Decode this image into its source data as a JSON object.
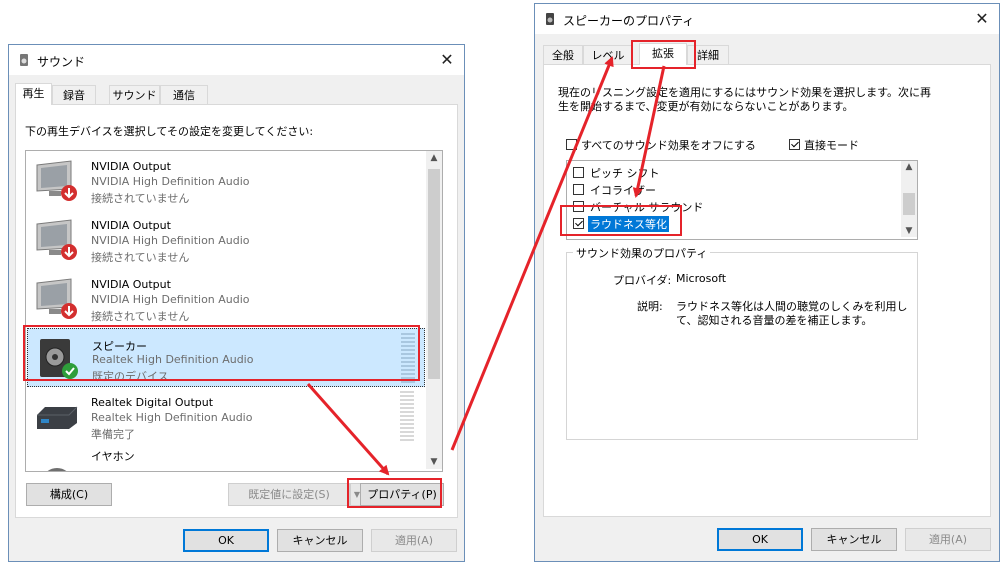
{
  "sound_dialog": {
    "title": "サウンド",
    "tabs": [
      {
        "label": "再生"
      },
      {
        "label": "録音"
      },
      {
        "label": "サウンド"
      },
      {
        "label": "通信"
      }
    ],
    "instruction": "下の再生デバイスを選択してその設定を変更してください:",
    "devices": [
      {
        "name": "NVIDIA Output",
        "driver": "NVIDIA High Definition Audio",
        "status": "接続されていません",
        "icon": "monitor-icon",
        "badge": "disconnected"
      },
      {
        "name": "NVIDIA Output",
        "driver": "NVIDIA High Definition Audio",
        "status": "接続されていません",
        "icon": "monitor-icon",
        "badge": "disconnected"
      },
      {
        "name": "NVIDIA Output",
        "driver": "NVIDIA High Definition Audio",
        "status": "接続されていません",
        "icon": "monitor-icon",
        "badge": "disconnected"
      },
      {
        "name": "スピーカー",
        "driver": "Realtek High Definition Audio",
        "status": "既定のデバイス",
        "icon": "speaker-icon",
        "badge": "default",
        "selected": true
      },
      {
        "name": "Realtek Digital Output",
        "driver": "Realtek High Definition Audio",
        "status": "準備完了",
        "icon": "receiver-icon",
        "badge": "none"
      },
      {
        "name": "イヤホン",
        "driver": "",
        "status": "",
        "icon": "headphone-icon",
        "badge": "none"
      }
    ],
    "configure_label": "構成(C)",
    "set_default_label": "既定値に設定(S)",
    "properties_label": "プロパティ(P)",
    "ok_label": "OK",
    "cancel_label": "キャンセル",
    "apply_label": "適用(A)"
  },
  "speaker_props": {
    "title": "スピーカーのプロパティ",
    "tabs": [
      {
        "label": "全般"
      },
      {
        "label": "レベル"
      },
      {
        "label": "拡張"
      },
      {
        "label": "詳細"
      }
    ],
    "description_line1": "現在のリスニング設定を適用にするにはサウンド効果を選択します。次に再",
    "description_line2": "生を開始するまで、変更が有効にならないことがあります。",
    "disable_all_label": "すべてのサウンド効果をオフにする",
    "immediate_mode_label": "直接モード",
    "effects": [
      {
        "label": "ピッチ シフト",
        "checked": false
      },
      {
        "label": "イコライザー",
        "checked": false
      },
      {
        "label": "バーチャル サラウンド",
        "checked": false
      },
      {
        "label": "ラウドネス等化",
        "checked": true
      }
    ],
    "group_title": "サウンド効果のプロパティ",
    "provider_label": "プロバイダ:",
    "provider_value": "Microsoft",
    "description_label": "説明:",
    "effect_desc_line1": "ラウドネス等化は人間の聴覚のしくみを利用し",
    "effect_desc_line2": "て、認知される音量の差を補正します。",
    "ok_label": "OK",
    "cancel_label": "キャンセル",
    "apply_label": "適用(A)"
  },
  "colors": {
    "highlight": "#e5232a",
    "selection": "#cce8ff",
    "accent": "#0078d7"
  }
}
